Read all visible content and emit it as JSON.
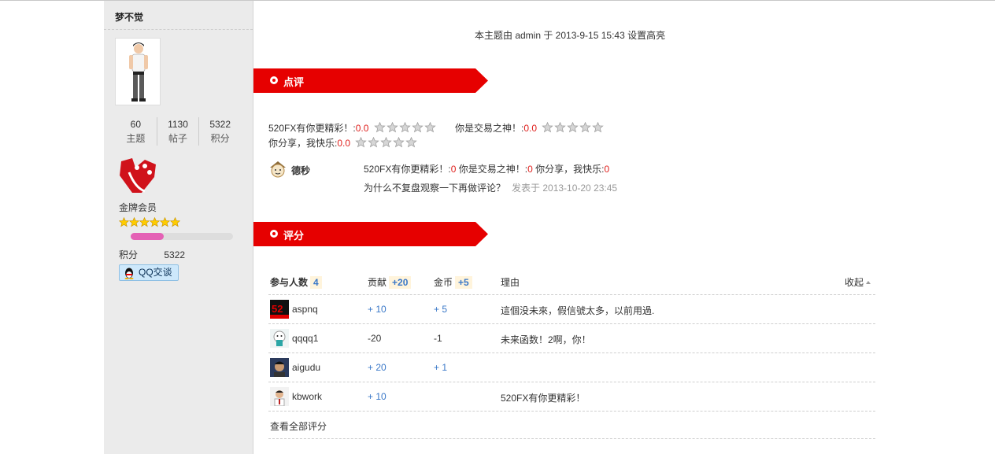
{
  "sidebar": {
    "username": "梦不觉",
    "stats": [
      {
        "num": "60",
        "label": "主题"
      },
      {
        "num": "1130",
        "label": "帖子"
      },
      {
        "num": "5322",
        "label": "积分"
      }
    ],
    "group": "金牌会员",
    "group_stars": 6,
    "progress_fraction": 0.32,
    "score_label": "积分",
    "score_value": "5322",
    "qq_label": "QQ交谈"
  },
  "main": {
    "highlight_note": "本主题由 admin 于 2013-9-15 15:43 设置高亮",
    "comments_section": {
      "title": "点评",
      "ratings_line1": [
        {
          "label": "520FX有你更精彩！:",
          "value": "0.0"
        },
        {
          "label": "你是交易之神！:",
          "value": "0.0"
        }
      ],
      "ratings_line2": [
        {
          "label": "你分享，我快乐:",
          "value": "0.0"
        }
      ],
      "comment": {
        "user": "德秒",
        "scores": [
          {
            "label": "520FX有你更精彩！:",
            "value": "0"
          },
          {
            "label": "你是交易之神！:",
            "value": "0"
          },
          {
            "label": "你分享，我快乐:",
            "value": "0"
          }
        ],
        "text": "为什么不复盘观察一下再做评论？",
        "time": "发表于 2013-10-20 23:45"
      }
    },
    "rating_section": {
      "title": "评分",
      "headers": {
        "participants_label": "参与人数",
        "participants_count": "4",
        "contribution_label": "贡献",
        "contribution_total": "+20",
        "gold_label": "金币",
        "gold_total": "+5",
        "reason_label": "理由",
        "collapse_label": "收起"
      },
      "rows": [
        {
          "user": "aspnq",
          "contribution": "+ 10",
          "gold": "+ 5",
          "reason": "這個没未來，假信號太多，以前用過."
        },
        {
          "user": "qqqq1",
          "contribution": "-20",
          "gold": "-1",
          "reason": "未来函数！2啊，你！"
        },
        {
          "user": "aigudu",
          "contribution": "+ 20",
          "gold": "+ 1",
          "reason": ""
        },
        {
          "user": "kbwork",
          "contribution": "+ 10",
          "gold": "",
          "reason": "520FX有你更精彩！"
        }
      ],
      "view_all": "查看全部评分"
    }
  },
  "colors": {
    "banner_red": "#e00000",
    "value_red": "#e0201d",
    "link_blue": "#3a78c8",
    "progress_pink": "#e461b5"
  }
}
